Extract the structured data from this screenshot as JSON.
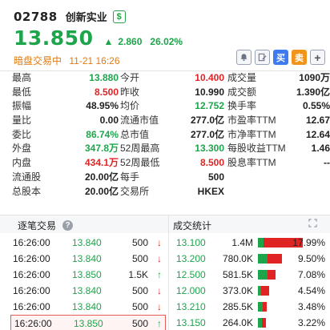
{
  "header": {
    "code": "02788",
    "name": "创新实业",
    "currency_icon": "$",
    "price": "13.850",
    "change": "2.860",
    "change_pct": "26.02%",
    "status": "暗盘交易中",
    "datetime": "11-21 16:26",
    "colors": {
      "up": "#1ea54c",
      "down": "#e02424",
      "status": "#e07b12",
      "buy": "#3f7bf0",
      "sell": "#f0951a"
    }
  },
  "toolbar": {
    "alert_icon": "bell-icon",
    "note_icon": "edit-icon",
    "buy_label": "买",
    "sell_label": "卖",
    "add_label": "+"
  },
  "stats": [
    [
      [
        "最高",
        "13.880",
        "green"
      ],
      [
        "今开",
        "10.400",
        "red"
      ],
      [
        "成交量",
        "1090万",
        "dark"
      ]
    ],
    [
      [
        "最低",
        "8.500",
        "red"
      ],
      [
        "昨收",
        "10.990",
        "dark"
      ],
      [
        "成交额",
        "1.390亿",
        "dark"
      ]
    ],
    [
      [
        "振幅",
        "48.95%",
        "dark"
      ],
      [
        "均价",
        "12.752",
        "green"
      ],
      [
        "换手率",
        "0.55%",
        "dark"
      ]
    ],
    [
      [
        "量比",
        "0.00",
        "dark"
      ],
      [
        "流通市值",
        "277.0亿",
        "dark"
      ],
      [
        "市盈率TTM",
        "12.67",
        "dark"
      ]
    ],
    [
      [
        "委比",
        "86.74%",
        "green"
      ],
      [
        "总市值",
        "277.0亿",
        "dark"
      ],
      [
        "市净率TTM",
        "12.64",
        "dark"
      ]
    ],
    [
      [
        "外盘",
        "347.8万",
        "green"
      ],
      [
        "52周最高",
        "13.300",
        "green"
      ],
      [
        "每股收益TTM",
        "1.46",
        "dark"
      ]
    ],
    [
      [
        "内盘",
        "434.1万",
        "red"
      ],
      [
        "52周最低",
        "8.500",
        "red"
      ],
      [
        "股息率TTM",
        "--",
        "dark"
      ]
    ],
    [
      [
        "流通股",
        "20.00亿",
        "dark"
      ],
      [
        "每手",
        "500",
        "dark"
      ],
      [
        "",
        "",
        ""
      ]
    ],
    [
      [
        "总股本",
        "20.00亿",
        "dark"
      ],
      [
        "交易所",
        "HKEX",
        "dark"
      ],
      [
        "",
        "",
        ""
      ]
    ]
  ],
  "ticks_panel": {
    "title": "逐笔交易",
    "help_label": "?",
    "rows": [
      {
        "time": "16:26:00",
        "price": "13.840",
        "volume": "500",
        "dir": "↓",
        "dir_class": "dir-down"
      },
      {
        "time": "16:26:00",
        "price": "13.840",
        "volume": "500",
        "dir": "↓",
        "dir_class": "dir-down"
      },
      {
        "time": "16:26:00",
        "price": "13.850",
        "volume": "1.5K",
        "dir": "↑",
        "dir_class": "dir-up"
      },
      {
        "time": "16:26:00",
        "price": "13.840",
        "volume": "500",
        "dir": "↓",
        "dir_class": "dir-down"
      },
      {
        "time": "16:26:00",
        "price": "13.840",
        "volume": "500",
        "dir": "↓",
        "dir_class": "dir-down"
      },
      {
        "time": "16:26:00",
        "price": "13.850",
        "volume": "500",
        "dir": "↑",
        "dir_class": "dir-up"
      }
    ]
  },
  "dist_panel": {
    "title": "成交统计",
    "expand_icon": "expand-icon",
    "rows": [
      {
        "price": "13.100",
        "volume": "1.4M",
        "pct": "17.99%",
        "share": 0.1799,
        "buy_ratio": 0.12
      },
      {
        "price": "13.200",
        "volume": "780.0K",
        "pct": "9.50%",
        "share": 0.095,
        "buy_ratio": 0.4
      },
      {
        "price": "12.500",
        "volume": "581.5K",
        "pct": "7.08%",
        "share": 0.0708,
        "buy_ratio": 0.55
      },
      {
        "price": "12.000",
        "volume": "373.0K",
        "pct": "4.54%",
        "share": 0.0454,
        "buy_ratio": 0.3
      },
      {
        "price": "13.210",
        "volume": "285.5K",
        "pct": "3.48%",
        "share": 0.0348,
        "buy_ratio": 0.5
      },
      {
        "price": "13.150",
        "volume": "264.0K",
        "pct": "3.22%",
        "share": 0.0322,
        "buy_ratio": 0.45
      }
    ]
  }
}
